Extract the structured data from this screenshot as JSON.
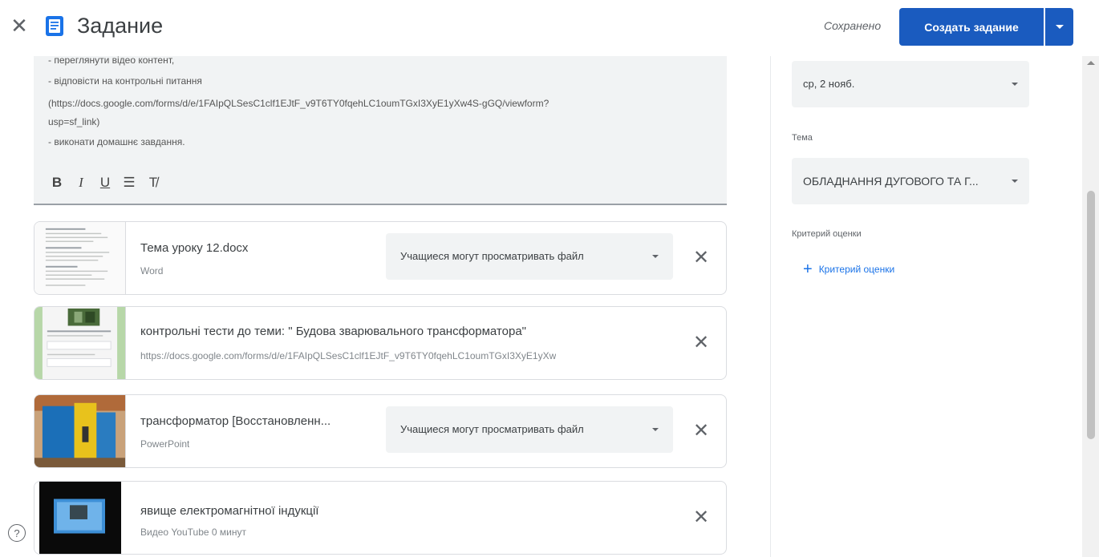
{
  "header": {
    "title": "Задание",
    "saved": "Сохранено",
    "create_label": "Создать задание",
    "colors": {
      "primary": "#1a5bbf"
    }
  },
  "description": {
    "lines": [
      "- переглянути відео контент,",
      "- відповісти на контрольні питання",
      "(https://docs.google.com/forms/d/e/1FAIpQLSesC1clf1EJtF_v9T6TY0fqehLC1oumTGxI3XyE1yXw4S-gGQ/viewform?",
      "usp=sf_link)",
      "- виконати домашнє завдання."
    ],
    "format_buttons": [
      "B",
      "I",
      "U",
      "☰",
      "T̸"
    ]
  },
  "attachments": [
    {
      "title": "Тема уроку 12.docx",
      "subtitle": "Word",
      "permission": "Учащиеся могут просматривать файл",
      "thumb": "doc"
    },
    {
      "title": "контрольні тести до теми: \" Будова зварювального трансформатора\"",
      "subtitle": "https://docs.google.com/forms/d/e/1FAIpQLSesC1clf1EJtF_v9T6TY0fqehLC1oumTGxI3XyE1yXw",
      "thumb": "form"
    },
    {
      "title": "трансформатор [Восстановленн...",
      "subtitle": "PowerPoint",
      "permission": "Учащиеся могут просматривать файл",
      "thumb": "ppt"
    },
    {
      "title": "явище електромагнітної індукції",
      "subtitle": "Видео YouTube  0 минут",
      "thumb": "video"
    }
  ],
  "side": {
    "due_value": "ср, 2 нояб.",
    "topic_label": "Тема",
    "topic_value": "ОБЛАДНАННЯ ДУГОВОГО ТА Г...",
    "criteria_label": "Критерий оценки",
    "add_criteria": "Критерий оценки"
  },
  "help": "?"
}
